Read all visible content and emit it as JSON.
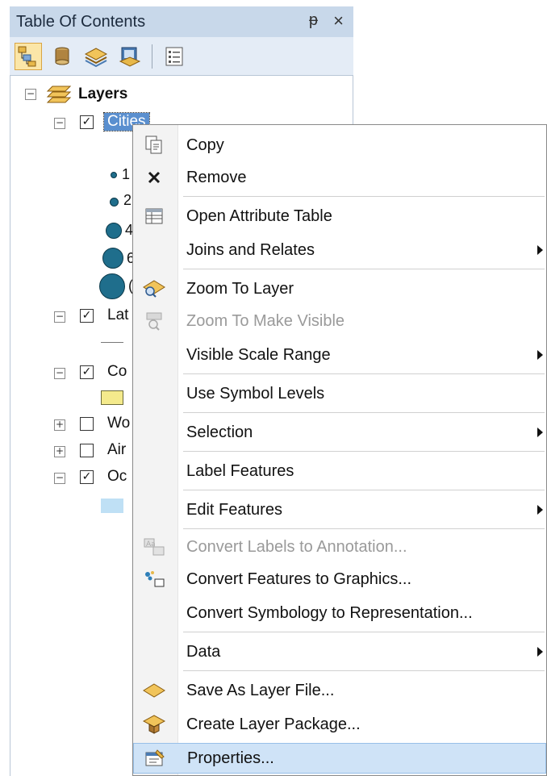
{
  "toc": {
    "title": "Table Of Contents",
    "pin_glyph": "ᵽ",
    "close_glyph": "×",
    "toolbar_icons": [
      "list-by-drawing-order-icon",
      "list-by-source-icon",
      "list-by-visibility-icon",
      "list-by-selection-icon",
      "options-icon"
    ],
    "root_label": "Layers",
    "layers": [
      {
        "label": "Cities",
        "checked": true,
        "expanded": true
      },
      {
        "label": "Lat",
        "checked": true,
        "expanded": true
      },
      {
        "label": "Co",
        "checked": true,
        "expanded": true
      },
      {
        "label": "Wo",
        "checked": false,
        "expanded": false
      },
      {
        "label": "Air",
        "checked": false,
        "expanded": false
      },
      {
        "label": "Oc",
        "checked": true,
        "expanded": true
      }
    ],
    "city_symbol_labels": [
      "1",
      "2",
      "4",
      "6",
      "("
    ]
  },
  "context_menu": {
    "items": [
      {
        "label": "Copy",
        "icon": "copy-icon",
        "disabled": false,
        "submenu": false
      },
      {
        "label": "Remove",
        "icon": "remove-icon",
        "disabled": false,
        "submenu": false
      },
      {
        "label": "Open Attribute Table",
        "icon": "attribute-table-icon",
        "disabled": false,
        "submenu": false
      },
      {
        "label": "Joins and Relates",
        "icon": "",
        "disabled": false,
        "submenu": true
      },
      {
        "label": "Zoom To Layer",
        "icon": "zoom-to-layer-icon",
        "disabled": false,
        "submenu": false
      },
      {
        "label": "Zoom To Make Visible",
        "icon": "zoom-to-make-visible-icon",
        "disabled": true,
        "submenu": false
      },
      {
        "label": "Visible Scale Range",
        "icon": "",
        "disabled": false,
        "submenu": true
      },
      {
        "label": "Use Symbol Levels",
        "icon": "",
        "disabled": false,
        "submenu": false
      },
      {
        "label": "Selection",
        "icon": "",
        "disabled": false,
        "submenu": true
      },
      {
        "label": "Label Features",
        "icon": "",
        "disabled": false,
        "submenu": false
      },
      {
        "label": "Edit Features",
        "icon": "",
        "disabled": false,
        "submenu": true
      },
      {
        "label": "Convert Labels to Annotation...",
        "icon": "convert-labels-icon",
        "disabled": true,
        "submenu": false
      },
      {
        "label": "Convert Features to Graphics...",
        "icon": "convert-features-icon",
        "disabled": false,
        "submenu": false
      },
      {
        "label": "Convert Symbology to Representation...",
        "icon": "",
        "disabled": false,
        "submenu": false
      },
      {
        "label": "Data",
        "icon": "",
        "disabled": false,
        "submenu": true
      },
      {
        "label": "Save As Layer File...",
        "icon": "save-layer-file-icon",
        "disabled": false,
        "submenu": false
      },
      {
        "label": "Create Layer Package...",
        "icon": "layer-package-icon",
        "disabled": false,
        "submenu": false
      },
      {
        "label": "Properties...",
        "icon": "properties-icon",
        "disabled": false,
        "submenu": false,
        "highlighted": true
      }
    ]
  }
}
